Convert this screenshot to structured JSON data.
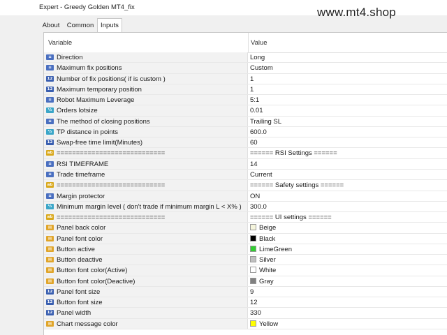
{
  "window": {
    "title": "Expert - Greedy Golden MT4_fix"
  },
  "watermark": "www.mt4.shop",
  "tabs": [
    {
      "label": "About"
    },
    {
      "label": "Common"
    },
    {
      "label": "Inputs",
      "active": true
    }
  ],
  "table": {
    "headers": {
      "variable": "Variable",
      "value": "Value"
    },
    "rows": [
      {
        "icon": "enm",
        "variable": "Direction",
        "value": "Long"
      },
      {
        "icon": "enm",
        "variable": "Maximum fix positions",
        "value": "Custom"
      },
      {
        "icon": "int",
        "variable": "Number of fix positions( if is custom )",
        "value": "1"
      },
      {
        "icon": "int",
        "variable": "Maximum temporary position",
        "value": "1"
      },
      {
        "icon": "enm",
        "variable": "Robot Maximum Leverage",
        "value": "5:1"
      },
      {
        "icon": "dbl",
        "variable": "Orders lotsize",
        "value": "0.01"
      },
      {
        "icon": "enm",
        "variable": "The method of closing positions",
        "value": "Trailing SL"
      },
      {
        "icon": "dbl",
        "variable": "TP distance in points",
        "value": "600.0"
      },
      {
        "icon": "int",
        "variable": "Swap-free time limit(Minutes)",
        "value": "60"
      },
      {
        "icon": "str",
        "variable": "============================",
        "value": "======  RSI Settings  ======"
      },
      {
        "icon": "enm",
        "variable": "RSI TIMEFRAME",
        "value": "14"
      },
      {
        "icon": "enm",
        "variable": "Trade timeframe",
        "value": "Current"
      },
      {
        "icon": "str",
        "variable": "============================",
        "value": "======  Safety settings  ======"
      },
      {
        "icon": "bool",
        "variable": "Margin protector",
        "value": "ON"
      },
      {
        "icon": "dbl",
        "variable": "Minimum margin level ( don't trade if minimum margin L < X% )",
        "value": "300.0"
      },
      {
        "icon": "str",
        "variable": "============================",
        "value": "======  UI settings  ======"
      },
      {
        "icon": "clr",
        "variable": "Panel back color",
        "value": "Beige",
        "swatch": "#f5f5dc"
      },
      {
        "icon": "clr",
        "variable": "Panel font color",
        "value": "Black",
        "swatch": "#000000"
      },
      {
        "icon": "clr",
        "variable": "Button active",
        "value": "LimeGreen",
        "swatch": "#32cd32"
      },
      {
        "icon": "clr",
        "variable": "Button deactive",
        "value": "Silver",
        "swatch": "#c0c0c0"
      },
      {
        "icon": "clr",
        "variable": "Button font color(Active)",
        "value": "White",
        "swatch": "#ffffff"
      },
      {
        "icon": "clr",
        "variable": "Button font color(Deactive)",
        "value": "Gray",
        "swatch": "#808080"
      },
      {
        "icon": "int",
        "variable": "Panel font size",
        "value": "9"
      },
      {
        "icon": "int",
        "variable": "Button font size",
        "value": "12"
      },
      {
        "icon": "int",
        "variable": "Panel width",
        "value": "330"
      },
      {
        "icon": "clr",
        "variable": "Chart message color",
        "value": "Yellow",
        "swatch": "#ffff00"
      }
    ]
  }
}
